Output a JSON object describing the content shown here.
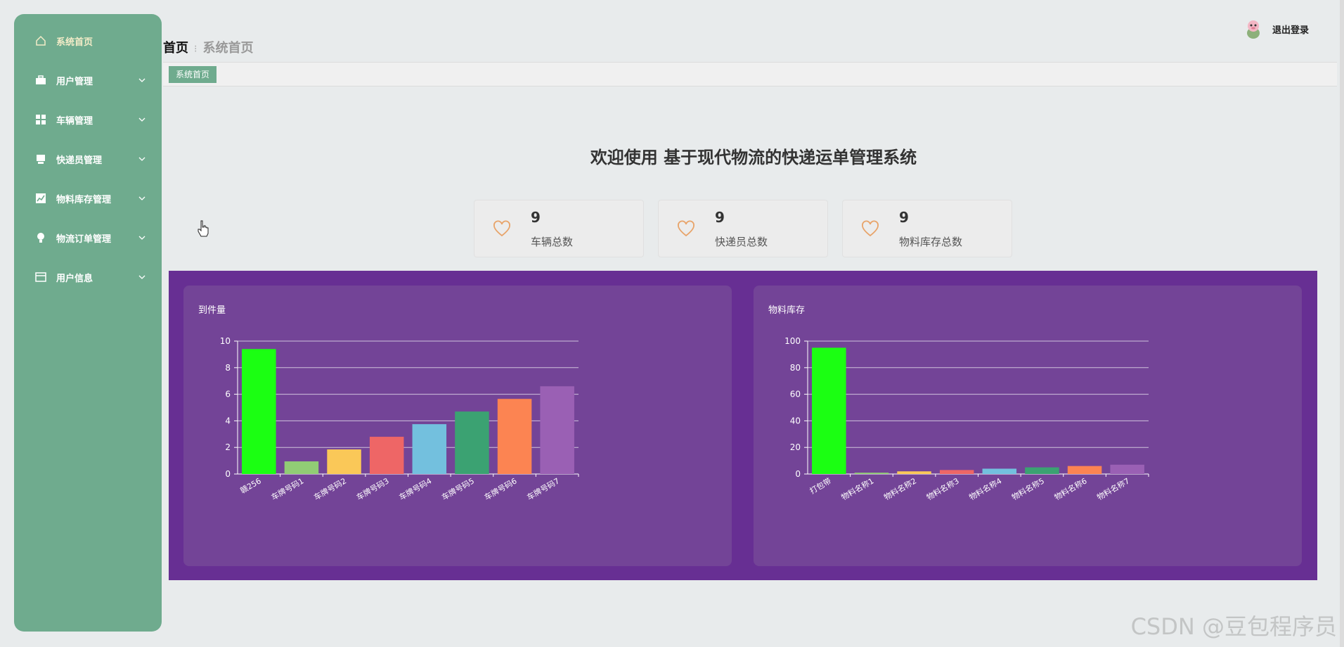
{
  "sidebar": {
    "items": [
      {
        "label": "系统首页",
        "icon": "home-icon",
        "active": true,
        "expandable": false
      },
      {
        "label": "用户管理",
        "icon": "briefcase-icon",
        "expandable": true
      },
      {
        "label": "车辆管理",
        "icon": "grid-icon",
        "expandable": true
      },
      {
        "label": "快递员管理",
        "icon": "printer-icon",
        "expandable": true
      },
      {
        "label": "物料库存管理",
        "icon": "chart-icon",
        "expandable": true
      },
      {
        "label": "物流订单管理",
        "icon": "bulb-icon",
        "expandable": true
      },
      {
        "label": "用户信息",
        "icon": "card-icon",
        "expandable": true
      }
    ]
  },
  "header": {
    "breadcrumb_home": "首页",
    "breadcrumb_sep": "⁝",
    "breadcrumb_current": "系统首页",
    "logout_label": "退出登录"
  },
  "tabs": [
    {
      "label": "系统首页"
    }
  ],
  "welcome": {
    "title": "欢迎使用 基于现代物流的快递运单管理系统"
  },
  "stats": [
    {
      "value": "9",
      "label": "车辆总数"
    },
    {
      "value": "9",
      "label": "快递员总数"
    },
    {
      "value": "9",
      "label": "物料库存总数"
    }
  ],
  "colors": {
    "sidebar": "#6fab8e",
    "panel": "#672f93",
    "chart_box": "#734497",
    "heart": "#e8a46a",
    "bars": [
      "#1bff12",
      "#91cc75",
      "#fac858",
      "#ee6666",
      "#73c0de",
      "#3ba272",
      "#fc8452",
      "#9a60b4"
    ]
  },
  "chart_data": [
    {
      "type": "bar",
      "title": "到件量",
      "categories": [
        "赣256",
        "车牌号码1",
        "车牌号码2",
        "车牌号码3",
        "车牌号码4",
        "车牌号码5",
        "车牌号码6",
        "车牌号码7"
      ],
      "values": [
        9.4,
        0.95,
        1.85,
        2.8,
        3.75,
        4.7,
        5.65,
        6.6
      ],
      "ylim": [
        0,
        10
      ],
      "yticks": [
        0,
        2,
        4,
        6,
        8,
        10
      ],
      "grid": true
    },
    {
      "type": "bar",
      "title": "物料库存",
      "categories": [
        "打包带",
        "物料名称1",
        "物料名称2",
        "物料名称3",
        "物料名称4",
        "物料名称5",
        "物料名称6",
        "物料名称7"
      ],
      "values": [
        95,
        1,
        2,
        3,
        4,
        5,
        6,
        7
      ],
      "ylim": [
        0,
        100
      ],
      "yticks": [
        0,
        20,
        40,
        60,
        80,
        100
      ],
      "grid": true
    }
  ],
  "watermark": "CSDN @豆包程序员"
}
